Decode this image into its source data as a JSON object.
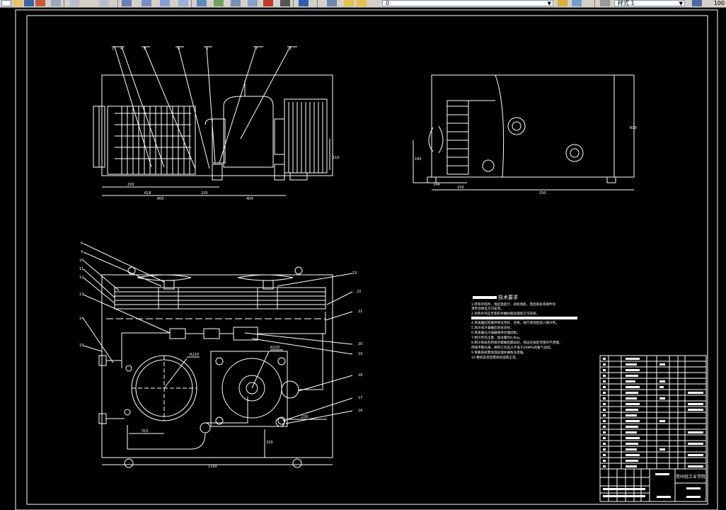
{
  "toolbar": {
    "layer_combo_value": "0",
    "style_combo_value": "样式 1",
    "zoom_value": "100",
    "icons": [
      "new-icon",
      "open-icon",
      "save-icon",
      "plot-icon",
      "undo-icon",
      "redo-icon",
      "pan-icon",
      "zoom-realtime-icon",
      "zoom-window-icon",
      "zoom-previous-icon",
      "properties-icon",
      "designcenter-icon",
      "tool-palettes-icon",
      "sheetset-icon",
      "markup-icon",
      "calculator-icon",
      "help-icon",
      "layer-manager-icon",
      "layer-state-icon",
      "text-style-icon",
      "dim-style-icon"
    ]
  },
  "colors": {
    "canvas": "#000000",
    "lines": "#ffffff",
    "toolbar": "#d4d0c8"
  },
  "drawing": {
    "top_view_dims": [
      "220",
      "618",
      "800",
      "220",
      "404",
      "110",
      "1020"
    ],
    "side_view_dims": [
      "144",
      "290",
      "330",
      "600",
      "150",
      "160"
    ],
    "plan_view_dims": [
      "1160",
      "315",
      "320",
      "230",
      "R220"
    ],
    "leader_numbers_top": [
      "2",
      "4",
      "8",
      "6",
      "5",
      "7",
      "1"
    ],
    "leader_numbers_plan_left": [
      "6",
      "9",
      "10",
      "11",
      "12",
      "13",
      "14",
      "15"
    ],
    "leader_numbers_plan_right": [
      "23",
      "22",
      "21",
      "20",
      "19",
      "18",
      "17",
      "16"
    ],
    "radius_labels": [
      "R220",
      "R220"
    ]
  },
  "tech_requirements": {
    "title": "技术要求",
    "lines": [
      "1.所有外购件、电控温度计、风机电机，电控系统等部件均",
      "须有合格证方可安装。",
      "2.风机外壳应无变形并做防腐处理后方可安装。",
      "3.",
      "4.蒸发器应检漏并保证完好，合格，进行清洗后加入制冷剂。",
      "5.风冷式冷凝器应安装良好。",
      "6.蒸发器与冷凝器保持合理间距。",
      "7.制冷剂充注量、加注量约0.8kg。",
      "8.制冷系统各焊接点需做检漏试验，保证在规定范围内不泄漏，",
      "焊缝平整光滑，保持工作压力不低于20MPa的氮气试验。",
      "9.管路系统需保温处理并做防冻措施。",
      "10.整机安装后需调试运转正常。"
    ]
  },
  "title_block": {
    "school_name": "常州轻工业学院",
    "row_count": 19
  }
}
